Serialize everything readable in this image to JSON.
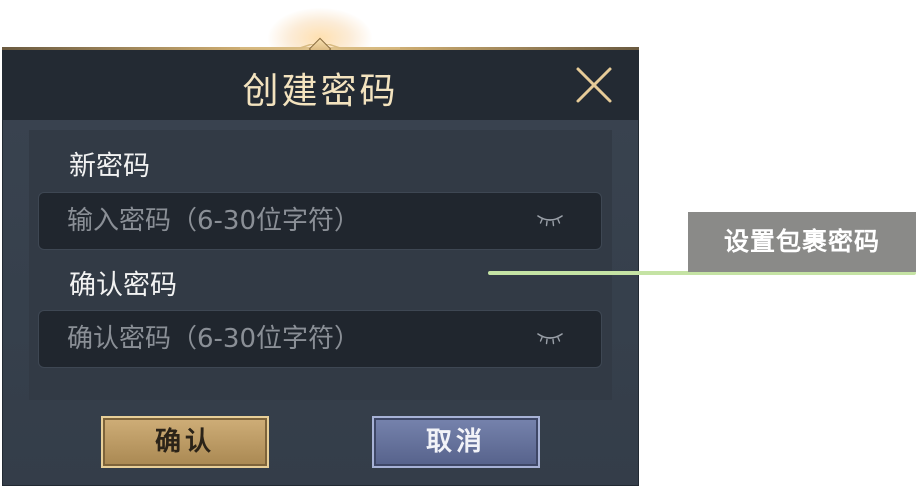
{
  "dialog": {
    "title": "创建密码",
    "close_icon": "close-icon"
  },
  "fields": {
    "new_password": {
      "label": "新密码",
      "placeholder": "输入密码（6-30位字符）",
      "value": "",
      "toggle_icon": "eye-closed-icon"
    },
    "confirm_password": {
      "label": "确认密码",
      "placeholder": "确认密码（6-30位字符）",
      "value": "",
      "toggle_icon": "eye-closed-icon"
    }
  },
  "buttons": {
    "confirm_label": "确认",
    "cancel_label": "取消"
  },
  "annotation": {
    "text": "设置包裹密码"
  },
  "colors": {
    "title_text": "#f3e3bf",
    "confirm_button": "#bd9c66",
    "cancel_button": "#66729c",
    "callout_line": "#c5e3a4",
    "callout_box": "#8a8a88"
  }
}
